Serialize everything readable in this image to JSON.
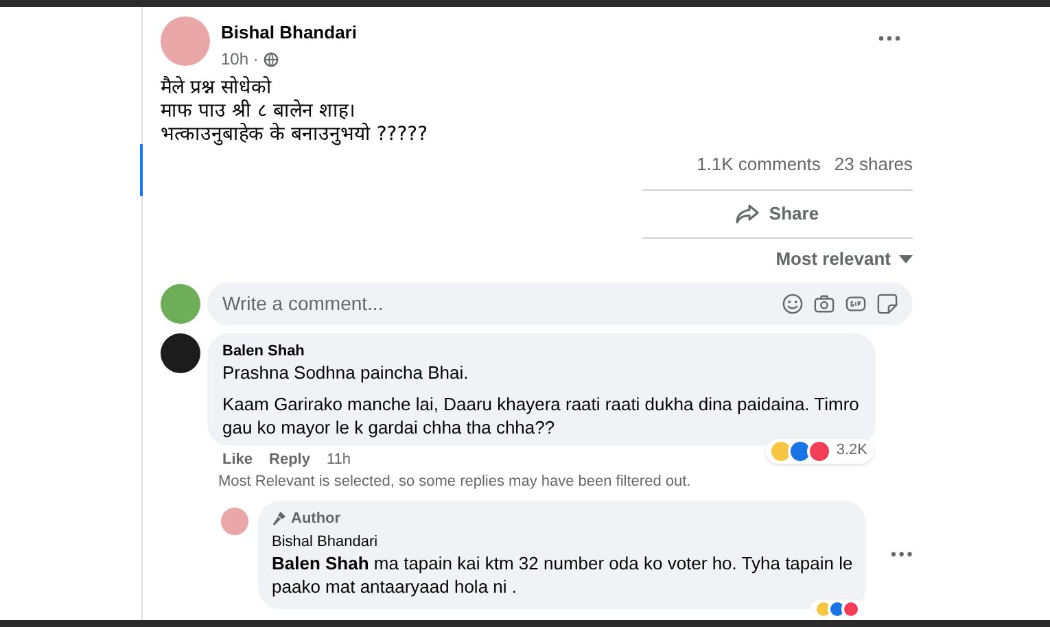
{
  "post": {
    "author": "Bishal Bhandari",
    "time": "10h",
    "separator": "·",
    "lines": [
      "मैले प्रश्न सोधेको",
      "माफ पाउ श्री ८ बालेन शाह।",
      "भत्काउनुबाहेक के बनाउनुभयो ?????"
    ],
    "comments_count": "1.1K comments",
    "shares_count": "23 shares",
    "share_label": "Share",
    "sort_label": "Most relevant"
  },
  "composer": {
    "placeholder": "Write a comment..."
  },
  "comments": [
    {
      "author": "Balen Shah",
      "paragraphs": [
        "Prashna Sodhna paincha Bhai.",
        "Kaam Garirako manche lai, Daaru khayera raati raati dukha dina paidaina. Timro gau ko mayor le k gardai chha tha chha??"
      ],
      "reaction_count": "3.2K",
      "actions": [
        "Like",
        "Reply"
      ],
      "time": "11h"
    }
  ],
  "filter_notice": "Most Relevant is selected, so some replies may have been filtered out.",
  "reply": {
    "badge": "Author",
    "author": "Bishal Bhandari",
    "mention": "Balen Shah",
    "text": "ma tapain kai ktm 32 number oda ko voter ho. Tyha tapain le paako mat antaaryaad hola ni ."
  }
}
